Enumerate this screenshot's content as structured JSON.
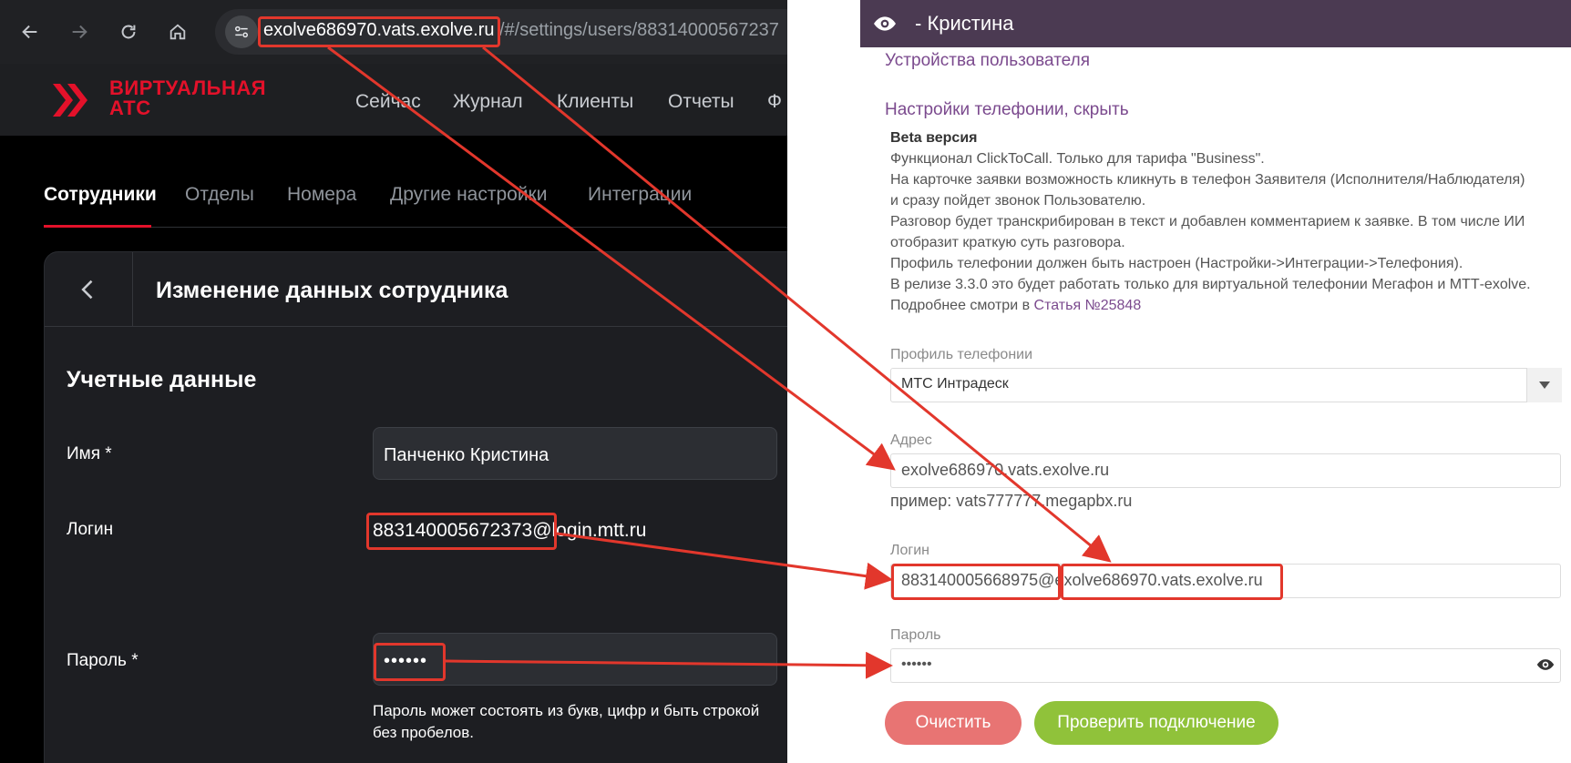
{
  "browser": {
    "url_host": "exolve686970.vats.exolve.ru",
    "url_path": "/#/settings/users/88314000567237"
  },
  "app": {
    "logo": {
      "line1": "ВИРТУАЛЬНАЯ",
      "line2": "АТС"
    },
    "top_nav": [
      "Сейчас",
      "Журнал",
      "Клиенты",
      "Отчеты",
      "Ф"
    ],
    "sub_tabs": [
      "Сотрудники",
      "Отделы",
      "Номера",
      "Другие настройки",
      "Интеграции"
    ],
    "active_sub_tab": "Сотрудники",
    "card_title": "Изменение данных сотрудника",
    "section_title": "Учетные данные",
    "fields": {
      "name_label": "Имя *",
      "name_value": "Панченко Кристина",
      "login_label": "Логин",
      "login_value": "883140005672373@login.mtt.ru",
      "password_label": "Пароль *",
      "password_value": "••••••",
      "password_hint": "Пароль может состоять из букв, цифр и быть строкой без пробелов."
    }
  },
  "panel": {
    "title": "- Кристина",
    "devices_link": "Устройства пользователя",
    "telephony_link": "Настройки телефонии, скрыть",
    "beta": {
      "title": "Beta версия",
      "lines": [
        "Функционал ClickToCall. Только для тарифа \"Business\".",
        "На карточке заявки возможность кликнуть в телефон Заявителя (Исполнителя/Наблюдателя)",
        "и сразу пойдет звонок Пользователю.",
        "Разговор будет транскрибирован в текст и добавлен комментарием к заявке. В том числе ИИ",
        "отобразит краткую суть разговора.",
        "Профиль телефонии должен быть настроен (Настройки->Интеграции->Телефония).",
        "В релизе 3.3.0 это будет работать только для виртуальной телефонии Мегафон и МТТ-exolve."
      ],
      "more_prefix": "Подробнее смотри в ",
      "more_link": "Статья №25848"
    },
    "profile_label": "Профиль телефонии",
    "profile_value": "МТС Интрадеск",
    "address_label": "Адрес",
    "address_value": "exolve686970.vats.exolve.ru",
    "address_example": "пример: vats777777.megapbx.ru",
    "login_label": "Логин",
    "login_value": "883140005668975@exolve686970.vats.exolve.ru",
    "password_label": "Пароль",
    "password_value": "••••••",
    "clear_button": "Очистить",
    "check_button": "Проверить подключение"
  },
  "colors": {
    "accent_red": "#e3112a",
    "annotation_red": "#e2372c",
    "panel_header": "#4b3a52",
    "link_purple": "#7b4a8e",
    "clear_button": "#e87473",
    "check_button": "#90c23a"
  },
  "icons": [
    "back-arrow-icon",
    "forward-arrow-icon",
    "reload-icon",
    "home-icon",
    "site-info-icon",
    "chevron-left-icon",
    "eye-icon",
    "dropdown-arrow-icon"
  ]
}
